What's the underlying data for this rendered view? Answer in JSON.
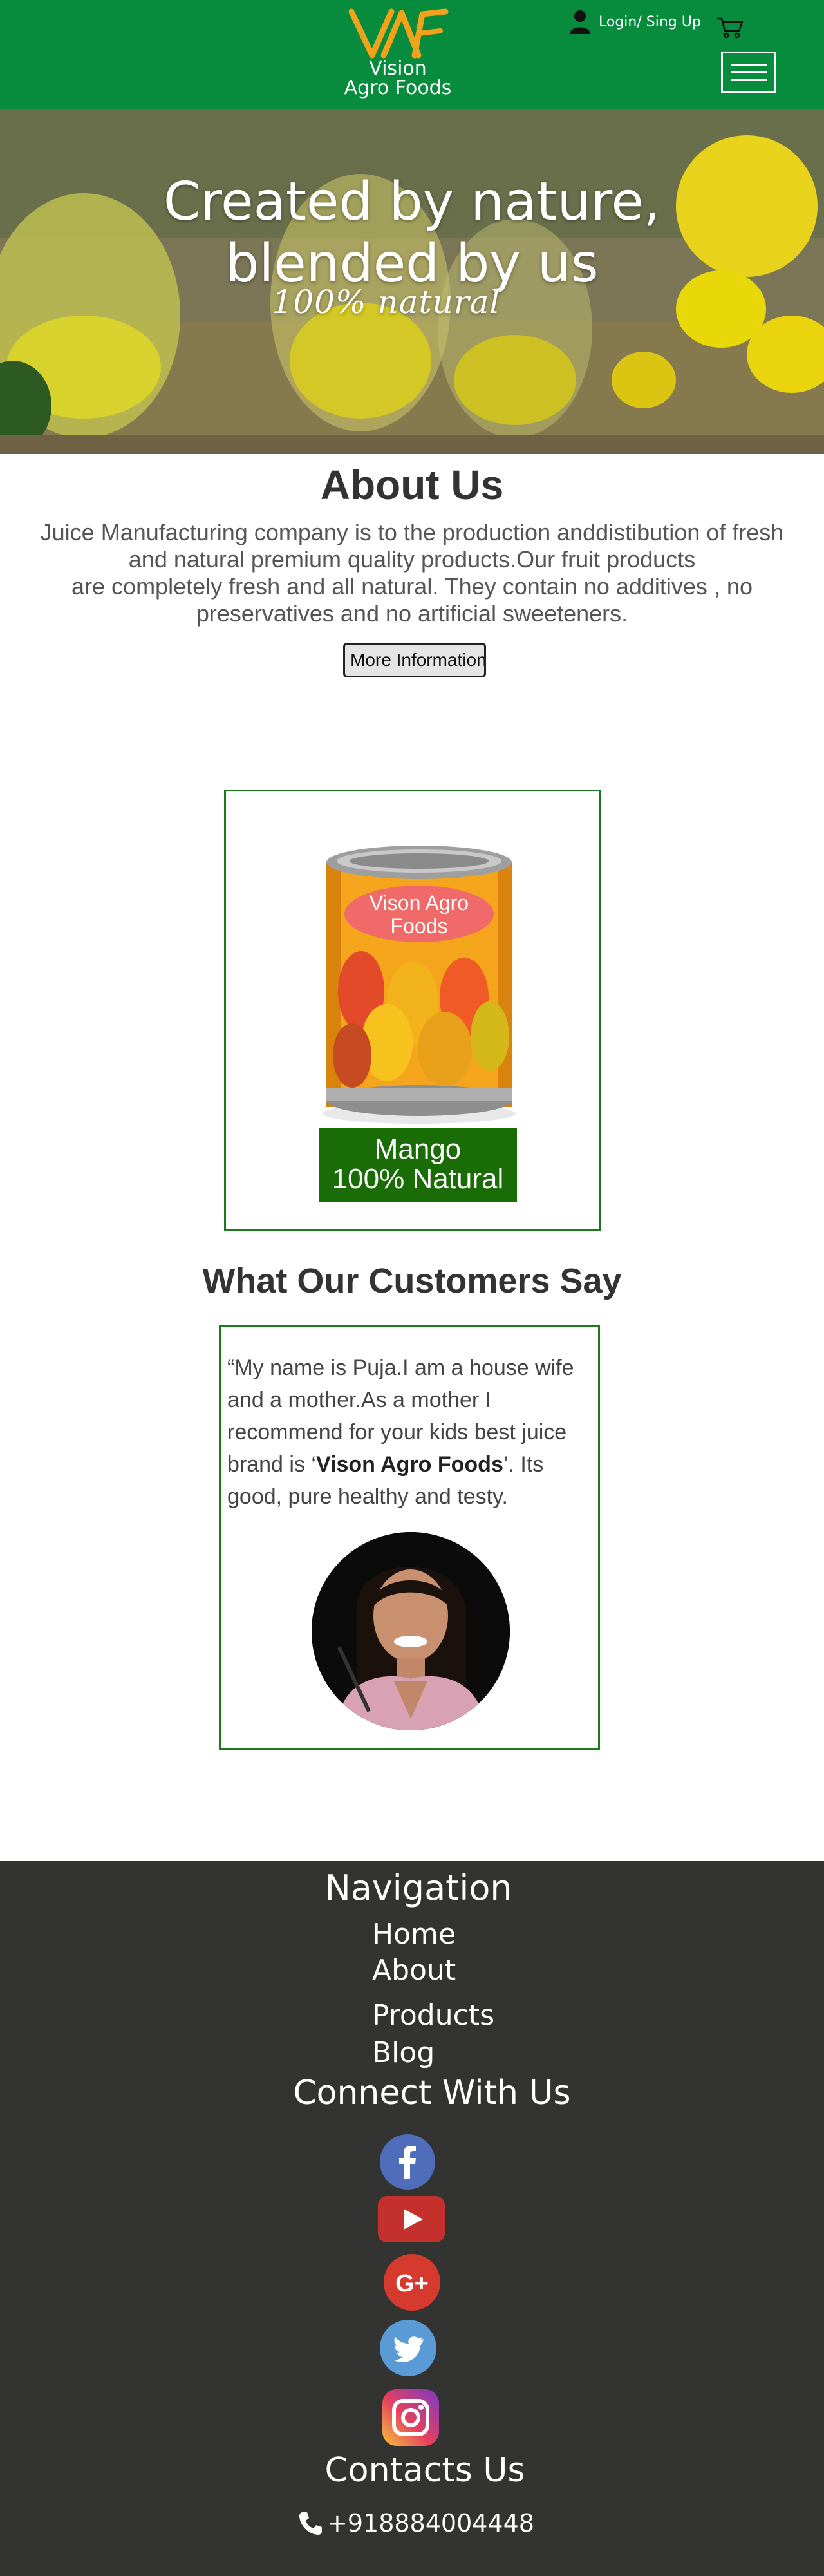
{
  "header": {
    "logo_mark": "VAF",
    "logo_line1": "Vision",
    "logo_line2": "Agro Foods",
    "login_label": "Login/ Sing Up",
    "icons": {
      "user": "user-icon",
      "cart": "cart-icon",
      "menu": "hamburger-menu-icon"
    },
    "background_color": "#078b3d"
  },
  "hero": {
    "title_line1": "Created by nature,",
    "title_line2": "blended by us",
    "subtitle": "100% natural"
  },
  "about": {
    "title": "About Us",
    "text_line1": "Juice Manufacturing company is to the production anddistibution of fresh",
    "text_line2": "and natural premium quality products.Our fruit products",
    "text_line3": "are completely fresh and all natural. They contain no additives , no",
    "text_line4": "preservatives and no artificial sweeteners.",
    "button_label": "More Information"
  },
  "product": {
    "can_label_line1": "Vison Agro",
    "can_label_line2": "Foods",
    "name_line1": "Mango",
    "name_line2": "100% Natural",
    "label_color": "#1a6d06"
  },
  "testimonials": {
    "title": "What Our Customers Say",
    "quote_before": "“My name is Puja.I am a house wife and a mother.As a mother I recommend for your kids best juice brand is ‘",
    "quote_brand": "Vison  Agro Foods",
    "quote_after": "’. Its good, pure healthy and testy."
  },
  "footer": {
    "nav_title": "Navigation",
    "nav_links": [
      "Home",
      "About",
      "Products",
      "Blog"
    ],
    "connect_title": "Connect With Us",
    "social_icons": [
      "facebook-icon",
      "youtube-icon",
      "google-plus-icon",
      "twitter-icon",
      "instagram-icon"
    ],
    "contacts_title": "Contacts Us",
    "phone": "+918884004448",
    "background_color": "#333432"
  }
}
